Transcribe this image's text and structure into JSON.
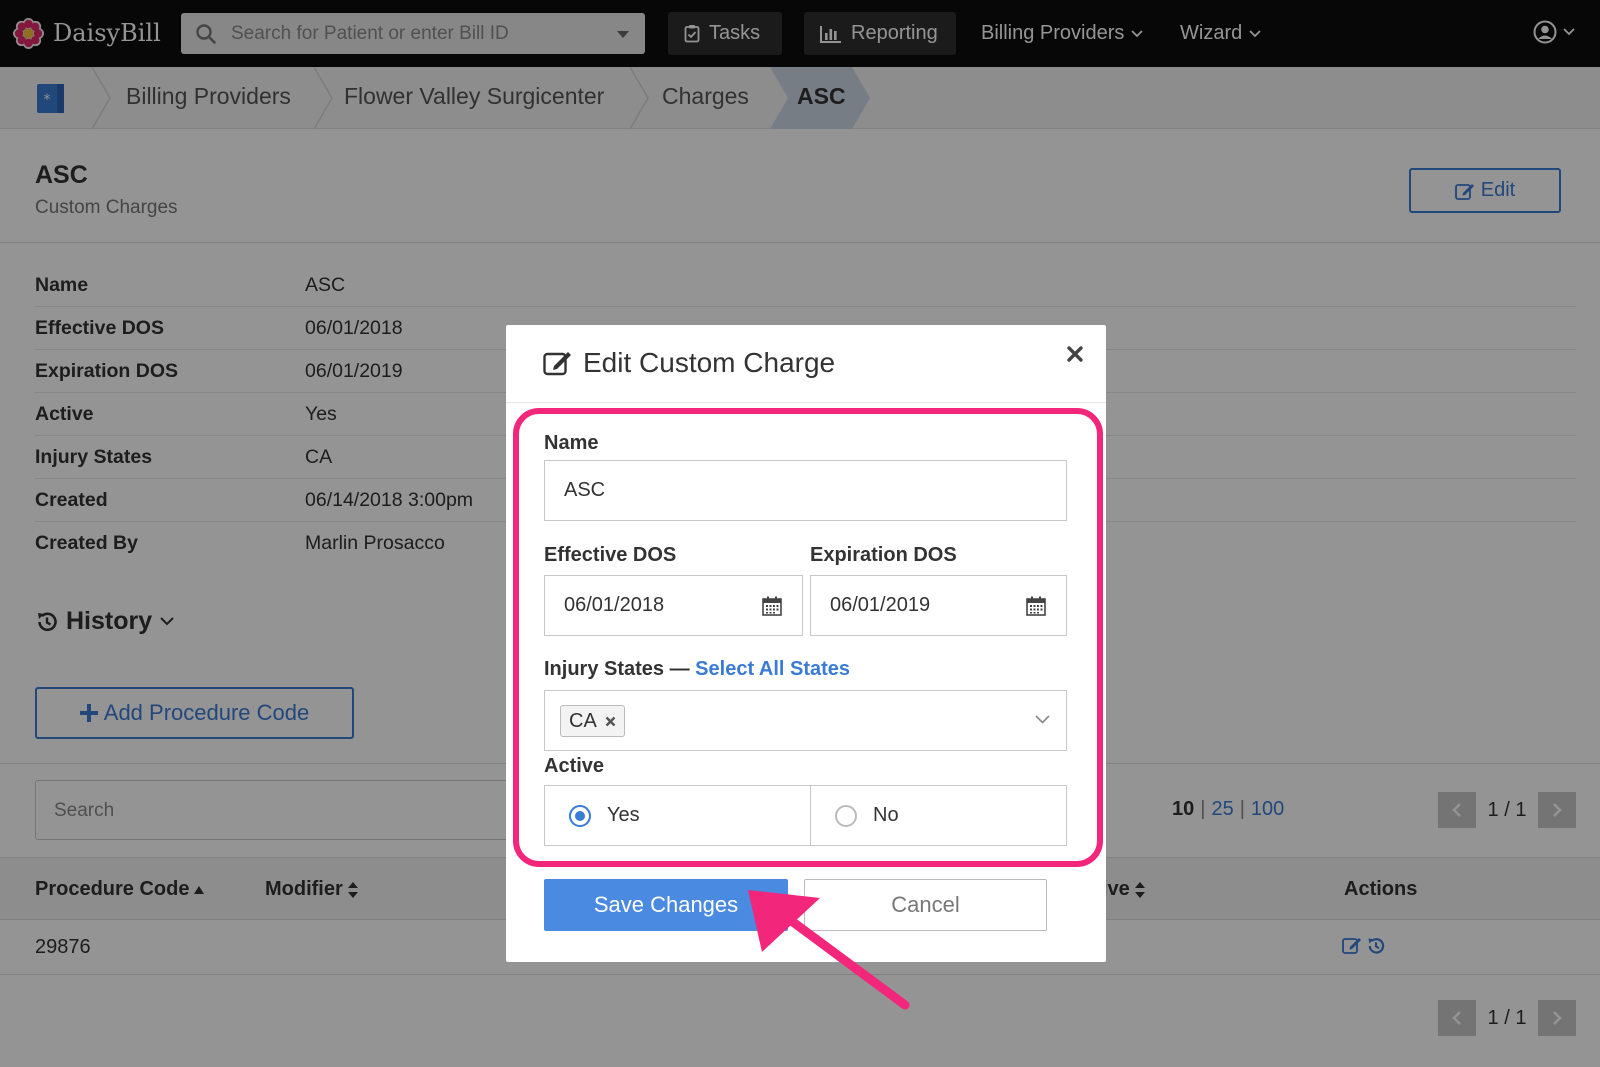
{
  "colors": {
    "accent": "#3a7bd5",
    "highlight": "#f2267a",
    "nav_bg": "#0d0d0d",
    "primary_button": "#4a8ae0"
  },
  "nav": {
    "brand": "DaisyBill",
    "search_placeholder": "Search for Patient or enter Bill ID",
    "tasks": "Tasks",
    "reporting": "Reporting",
    "billing_providers": "Billing Providers",
    "wizard": "Wizard",
    "icons": [
      "search-icon",
      "clipboard-check-icon",
      "bar-chart-icon",
      "user-circle-icon",
      "chevron-down-icon"
    ]
  },
  "breadcrumb": {
    "items": [
      "Billing Providers",
      "Flower Valley Surgicenter",
      "Charges",
      "ASC"
    ],
    "icon": "hospital-icon"
  },
  "page": {
    "title": "ASC",
    "subtitle": "Custom Charges",
    "edit_label": "Edit"
  },
  "details": [
    {
      "label": "Name",
      "value": "ASC"
    },
    {
      "label": "Effective DOS",
      "value": "06/01/2018"
    },
    {
      "label": "Expiration DOS",
      "value": "06/01/2019"
    },
    {
      "label": "Active",
      "value": "Yes"
    },
    {
      "label": "Injury States",
      "value": "CA"
    },
    {
      "label": "Created",
      "value": "06/14/2018 3:00pm"
    },
    {
      "label": "Created By",
      "value": "Marlin Prosacco"
    }
  ],
  "history_label": "History",
  "add_procedure_label": "Add Procedure Code",
  "table": {
    "search_placeholder": "Search",
    "per_page": [
      "10",
      "25",
      "100"
    ],
    "per_page_selected": "10",
    "page_indicator": "1 / 1",
    "columns": [
      "Procedure Code",
      "Modifier",
      "ive",
      "Actions"
    ],
    "rows": [
      {
        "procedure_code": "29876"
      }
    ]
  },
  "modal": {
    "title": "Edit Custom Charge",
    "name_label": "Name",
    "name_value": "ASC",
    "effective_label": "Effective DOS",
    "effective_value": "06/01/2018",
    "expiration_label": "Expiration DOS",
    "expiration_value": "06/01/2019",
    "injury_label": "Injury States —",
    "select_all": "Select All States",
    "injury_tags": [
      "CA"
    ],
    "active_label": "Active",
    "active_options": [
      "Yes",
      "No"
    ],
    "active_selected": "Yes",
    "save_label": "Save Changes",
    "cancel_label": "Cancel"
  }
}
